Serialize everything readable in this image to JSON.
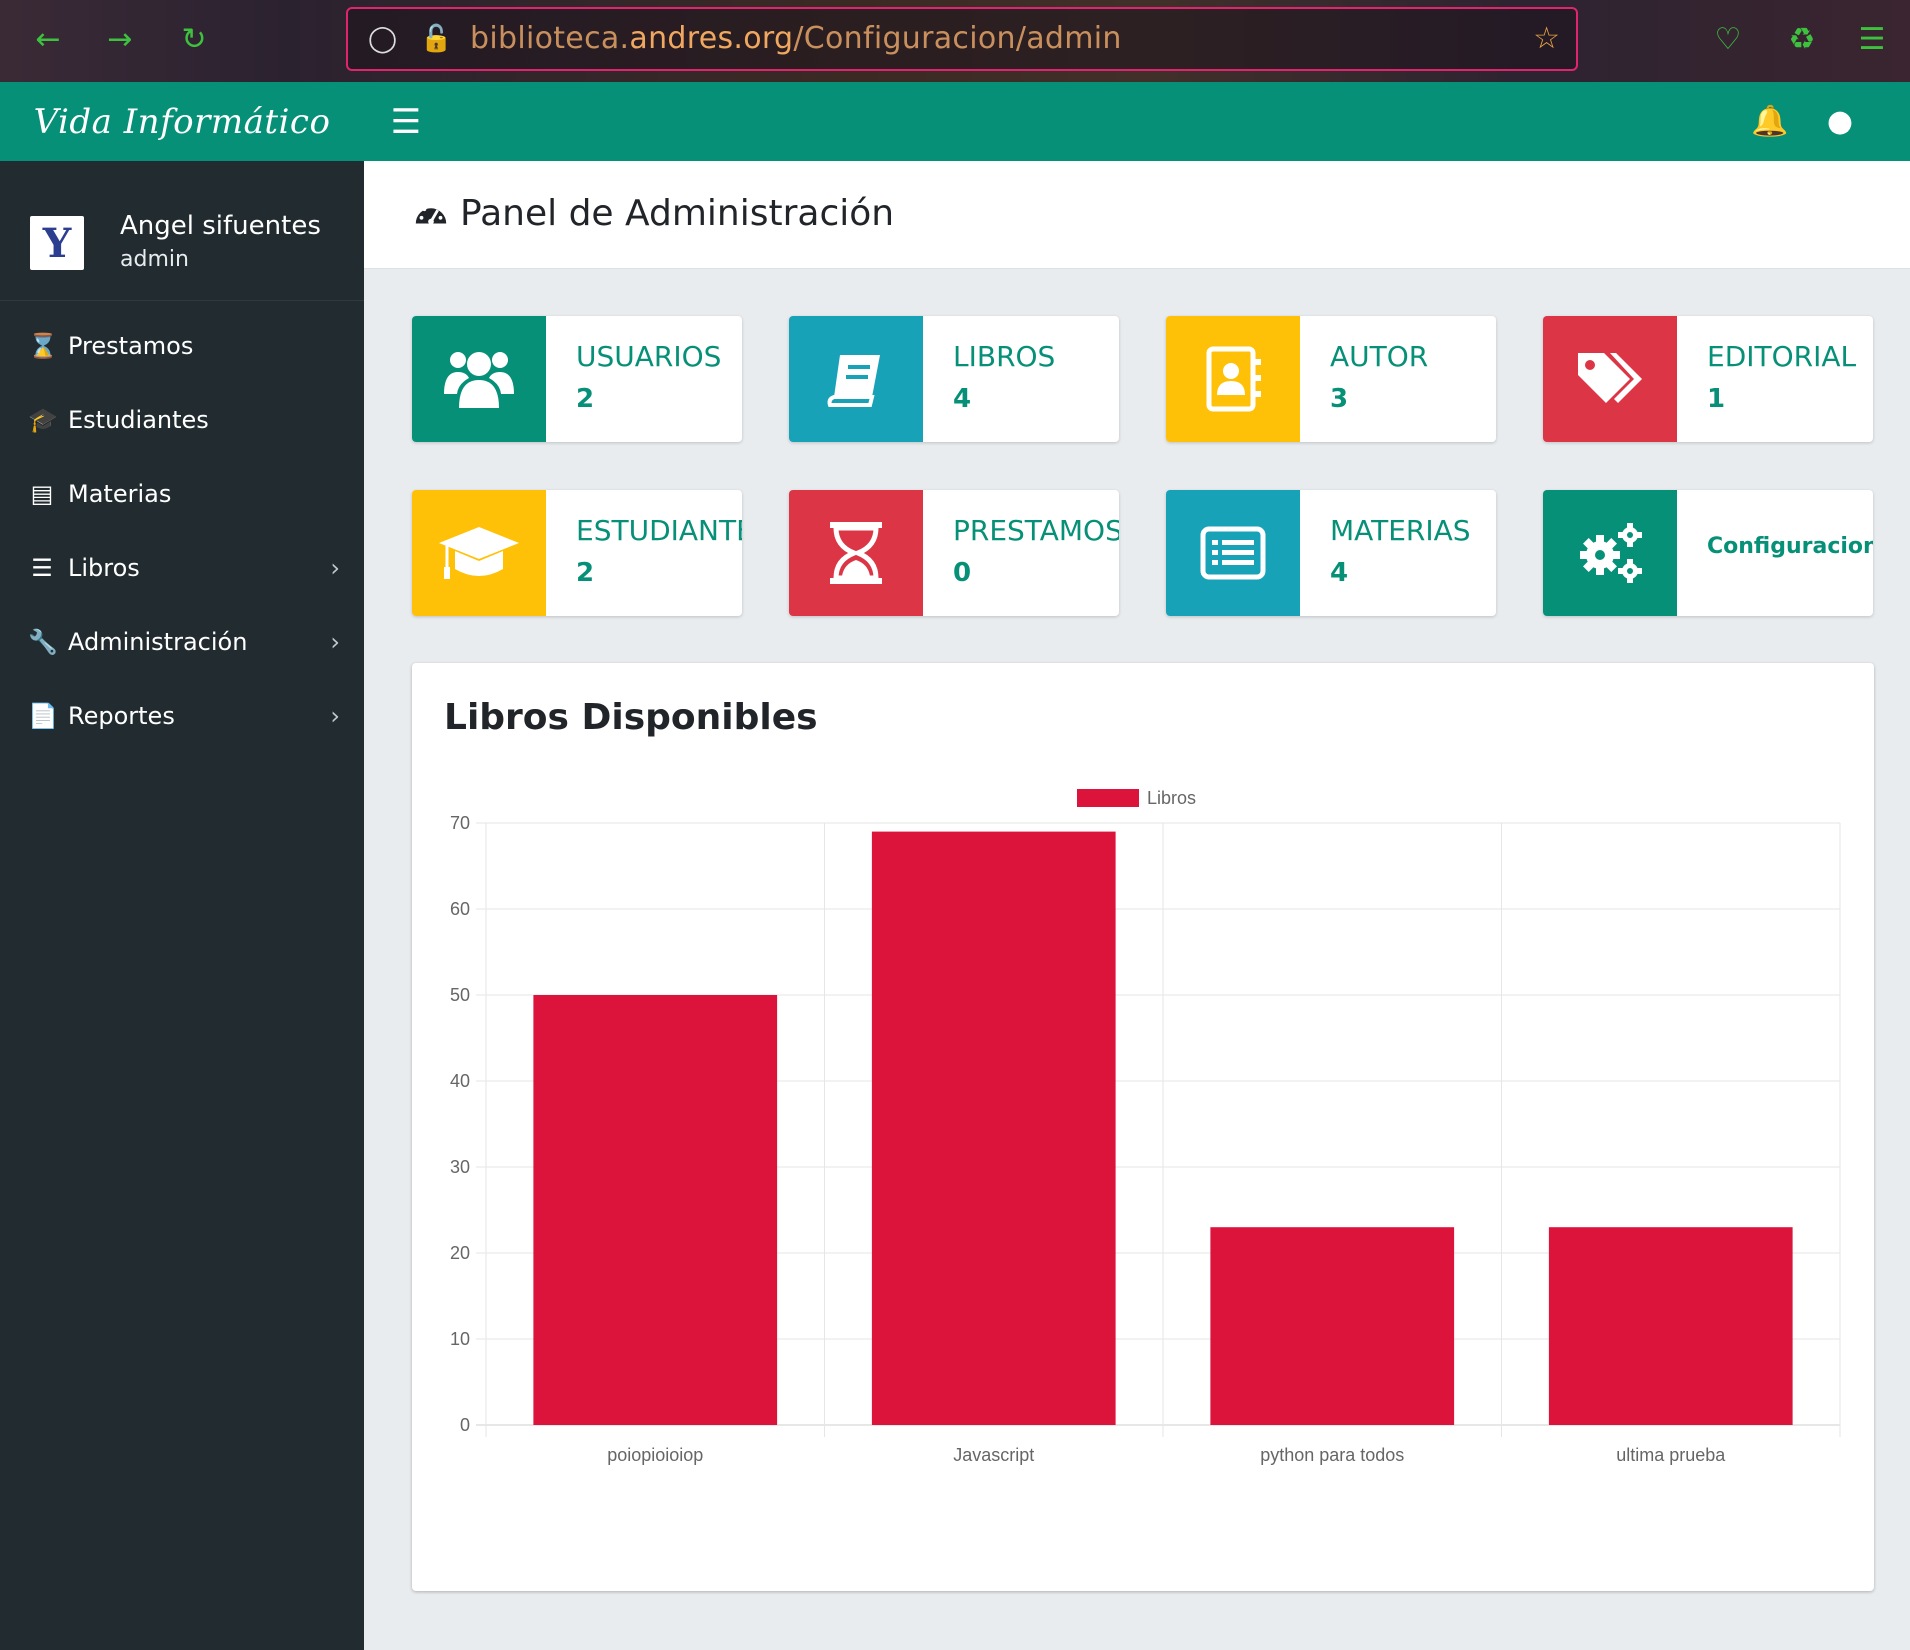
{
  "browser": {
    "url_prefix": "biblioteca.",
    "url_host": "andres.org",
    "url_path": "/Configuracion/admin"
  },
  "sidebar": {
    "brand": "Vida Informático",
    "user": {
      "name": "Angel sifuentes",
      "role": "admin"
    },
    "items": [
      {
        "label": "Prestamos",
        "icon": "hourglass-icon",
        "has_submenu": false
      },
      {
        "label": "Estudiantes",
        "icon": "graduation-cap-icon",
        "has_submenu": false
      },
      {
        "label": "Materias",
        "icon": "list-alt-icon",
        "has_submenu": false
      },
      {
        "label": "Libros",
        "icon": "list-icon",
        "has_submenu": true
      },
      {
        "label": "Administración",
        "icon": "wrench-icon",
        "has_submenu": true
      },
      {
        "label": "Reportes",
        "icon": "file-icon",
        "has_submenu": true
      }
    ]
  },
  "header": {
    "title": "Panel de Administración"
  },
  "boxes": [
    {
      "label": "USUARIOS",
      "value": "2",
      "color": "#079078",
      "icon": "users-icon"
    },
    {
      "label": "LIBROS",
      "value": "4",
      "color": "#17a2b8",
      "icon": "book-icon"
    },
    {
      "label": "AUTOR",
      "value": "3",
      "color": "#ffc107",
      "icon": "address-book-icon"
    },
    {
      "label": "EDITORIAL",
      "value": "1",
      "color": "#dc3545",
      "icon": "tags-icon"
    },
    {
      "label": "ESTUDIANTES",
      "value": "2",
      "color": "#ffc107",
      "icon": "graduation-cap-icon"
    },
    {
      "label": "PRESTAMOS",
      "value": "0",
      "color": "#dc3545",
      "icon": "hourglass-icon"
    },
    {
      "label": "MATERIAS",
      "value": "4",
      "color": "#17a2b8",
      "icon": "list-alt-icon"
    },
    {
      "label": "Configuracion",
      "value": "",
      "color": "#079078",
      "icon": "cogs-icon"
    }
  ],
  "card": {
    "title": "Libros Disponibles"
  },
  "chart_data": {
    "type": "bar",
    "categories": [
      "poiopioioiop",
      "Javascript",
      "python para todos",
      "ultima prueba"
    ],
    "series": [
      {
        "name": "Libros",
        "values": [
          50,
          69,
          23,
          23
        ],
        "color": "#dc143c"
      }
    ],
    "ylim": [
      0,
      70
    ],
    "yticks": [
      0,
      10,
      20,
      30,
      40,
      50,
      60,
      70
    ],
    "legend": "top-center",
    "grid": true
  }
}
